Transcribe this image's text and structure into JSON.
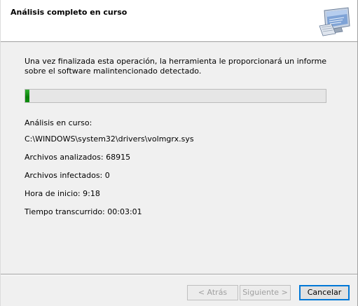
{
  "header": {
    "title": "Análisis completo en curso",
    "icon": "computer-scan-icon"
  },
  "main": {
    "description": "Una vez finalizada esta operación, la herramienta le proporcionará un informe sobre el software malintencionado detectado.",
    "progress_fraction": 0.015,
    "progress_color": "#0e8e0e",
    "status_label": "Análisis en curso:",
    "current_file": "C:\\WINDOWS\\system32\\drivers\\volmgrx.sys",
    "files_scanned": "Archivos analizados: 68915",
    "files_infected": "Archivos infectados: 0",
    "start_time": "Hora de inicio: 9:18",
    "elapsed_time": "Tiempo transcurrido: 00:03:01"
  },
  "footer": {
    "back_label": "< Atrás",
    "next_label": "Siguiente >",
    "cancel_label": "Cancelar"
  }
}
